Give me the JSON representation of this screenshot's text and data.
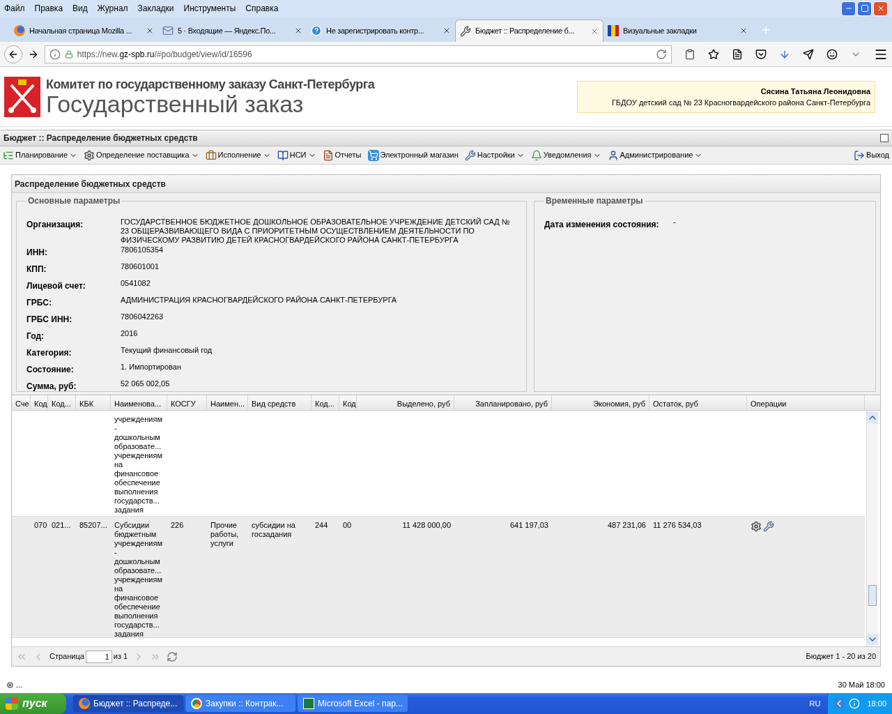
{
  "menu": [
    "Файл",
    "Правка",
    "Вид",
    "Журнал",
    "Закладки",
    "Инструменты",
    "Справка"
  ],
  "tabs": [
    {
      "label": "Начальная страница Mozilla ...",
      "selected": false
    },
    {
      "label": "5 · Входящие — Яндекс.По...",
      "selected": false
    },
    {
      "label": "Не зарегистрировать контр...",
      "selected": false
    },
    {
      "label": "Бюджет :: Распределение б...",
      "selected": true
    },
    {
      "label": "Визуальные закладки",
      "selected": false
    }
  ],
  "url": {
    "prefix": "https://new.",
    "host": "gz-spb.ru",
    "path": "/#po/budget/view/id/16596"
  },
  "site": {
    "committee": "Комитет по государственному заказу Санкт-Петербурга",
    "title": "Государственный заказ",
    "user": "Сясина Татьяна Леонидовна",
    "org": "ГБДОУ детский сад № 23 Красногвардейского района Санкт-Петербурга"
  },
  "app_title": "Бюджет :: Распределение бюджетных средств",
  "toolbar": [
    {
      "label": "Планирование",
      "dropdown": true
    },
    {
      "label": "Определение поставщика",
      "dropdown": true
    },
    {
      "label": "Исполнение",
      "dropdown": true
    },
    {
      "label": "НСИ",
      "dropdown": true
    },
    {
      "label": "Отчеты",
      "dropdown": false
    },
    {
      "label": "Электронный магазин",
      "dropdown": false
    },
    {
      "label": "Настройки",
      "dropdown": true
    },
    {
      "label": "Уведомления",
      "dropdown": true
    },
    {
      "label": "Администрирование",
      "dropdown": true
    }
  ],
  "logout": "Выход",
  "panel_title": "Распределение бюджетных средств",
  "main_params": {
    "legend": "Основные параметры",
    "fields": [
      {
        "label": "Организация:",
        "value": "ГОСУДАРСТВЕННОЕ БЮДЖЕТНОЕ ДОШКОЛЬНОЕ ОБРАЗОВАТЕЛЬНОЕ УЧРЕЖДЕНИЕ ДЕТСКИЙ САД № 23 ОБЩЕРАЗВИВАЮЩЕГО ВИДА С ПРИОРИТЕТНЫМ ОСУЩЕСТВЛЕНИЕМ ДЕЯТЕЛЬНОСТИ ПО ФИЗИЧЕСКОМУ РАЗВИТИЮ ДЕТЕЙ КРАСНОГВАРДЕЙСКОГО РАЙОНА САНКТ-ПЕТЕРБУРГА"
      },
      {
        "label": "ИНН:",
        "value": "7806105354"
      },
      {
        "label": "КПП:",
        "value": "780601001"
      },
      {
        "label": "Лицевой счет:",
        "value": "0541082"
      },
      {
        "label": "ГРБС:",
        "value": "АДМИНИСТРАЦИЯ КРАСНОГВАРДЕЙСКОГО РАЙОНА САНКТ-ПЕТЕРБУРГА"
      },
      {
        "label": "ГРБС ИНН:",
        "value": "7806042263"
      },
      {
        "label": "Год:",
        "value": "2016"
      },
      {
        "label": "Категория:",
        "value": "Текущий финансовый год"
      },
      {
        "label": "Состояние:",
        "value": "1. Импортирован"
      },
      {
        "label": "Сумма, руб:",
        "value": "52 065 002,05"
      }
    ]
  },
  "time_params": {
    "legend": "Временные параметры",
    "fields": [
      {
        "label": "Дата изменения состояния:",
        "value": "-"
      }
    ]
  },
  "table": {
    "columns": [
      "Сче",
      "Код",
      "Код...",
      "КБК",
      "Наименова...",
      "КОСГУ",
      "Наимен...",
      "Вид средств",
      "Код...",
      "Код",
      "Выделено, руб",
      "Запланировано, руб",
      "Экономия, руб",
      "Остаток, руб",
      "Операции"
    ],
    "rows": [
      {
        "selected": false,
        "actions": false,
        "cells": {
          "name": "учреждениям\n-\nдошкольным\nобразовате...\nучреждениям\nна\nфинансовое\nобеспечение\nвыполнения\nгосударств...\nзадания"
        }
      },
      {
        "selected": true,
        "actions": true,
        "cells": {
          "code1": "070",
          "code2": "021...",
          "kbk": "85207...",
          "name": "Субсидии\nбюджетным\nучреждениям\n-\nдошкольным\nобразовате...\nучреждениям\nна\nфинансовое\nобеспечение\nвыполнения\nгосударств...\nзадания",
          "kosgu": "226",
          "kosgu_name": "Прочие\nработы,\nуслуги",
          "funds": "субсидии на\nгосзадания",
          "code3": "244",
          "code4": "00",
          "allocated": "11 428 000,00",
          "planned": "641 197,03",
          "savings": "487 231,06",
          "balance": "11 276 534,03"
        }
      }
    ]
  },
  "pager": {
    "page_label": "Страница",
    "page": "1",
    "of": "из 1",
    "summary": "Бюджет 1 - 20 из 20"
  },
  "status": {
    "left": "...",
    "right": "30 Май 18:00"
  },
  "taskbar": {
    "start": "пуск",
    "items": [
      {
        "label": "Бюджет :: Распреде...",
        "selected": true
      },
      {
        "label": "Закупки :: Контрак...",
        "selected": false
      },
      {
        "label": "Microsoft Excel - пар...",
        "selected": false
      }
    ],
    "lang": "RU",
    "clock": "18:00"
  }
}
